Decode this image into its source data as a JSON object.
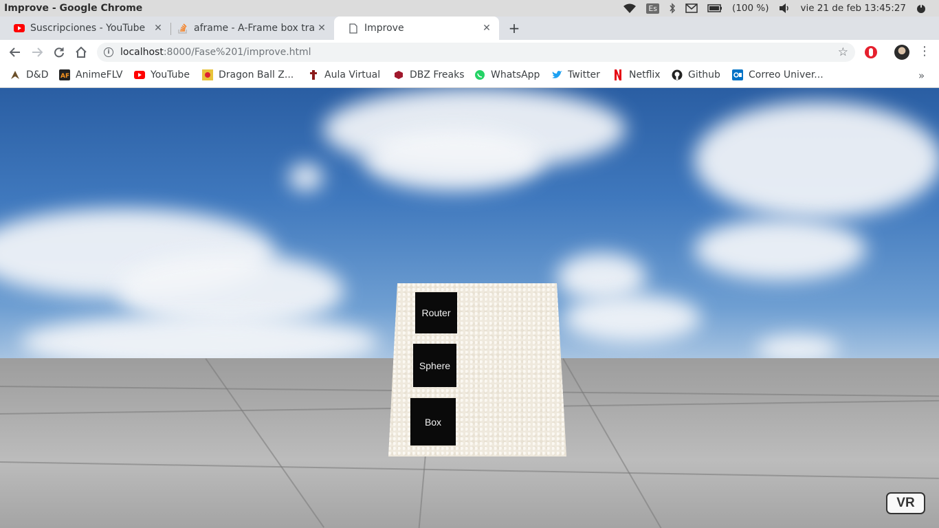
{
  "os_bar": {
    "window_title": "Improve - Google Chrome",
    "lang": "Es",
    "battery": "(100 %)",
    "datetime": "vie 21 de feb 13:45:27",
    "icons": [
      "wifi-icon",
      "bluetooth-icon",
      "mail-icon",
      "battery-icon",
      "volume-icon",
      "power-icon"
    ]
  },
  "tabs": [
    {
      "label": "Suscripciones - YouTube",
      "favicon": "youtube-icon",
      "active": false
    },
    {
      "label": "aframe - A-Frame box tran",
      "favicon": "stackoverflow-icon",
      "active": false
    },
    {
      "label": "Improve",
      "favicon": "page-icon",
      "active": true
    }
  ],
  "toolbar": {
    "url_host": "localhost",
    "url_path": ":8000/Fase%201/improve.html"
  },
  "bookmarks": [
    {
      "label": "D&D",
      "icon": "dnd-icon"
    },
    {
      "label": "AnimeFLV",
      "icon": "animeflv-icon"
    },
    {
      "label": "YouTube",
      "icon": "youtube-icon"
    },
    {
      "label": "Dragon Ball Z...",
      "icon": "dragonball-icon"
    },
    {
      "label": "Aula Virtual",
      "icon": "aula-virtual-icon"
    },
    {
      "label": "DBZ Freaks",
      "icon": "dbz-freaks-icon"
    },
    {
      "label": "WhatsApp",
      "icon": "whatsapp-icon"
    },
    {
      "label": "Twitter",
      "icon": "twitter-icon"
    },
    {
      "label": "Netflix",
      "icon": "netflix-icon"
    },
    {
      "label": "Github",
      "icon": "github-icon"
    },
    {
      "label": "Correo Univer...",
      "icon": "outlook-icon"
    }
  ],
  "scene": {
    "buttons": [
      "Router",
      "Sphere",
      "Box"
    ],
    "vr_label": "VR"
  },
  "colors": {
    "tab_strip": "#dee1e6",
    "youtube_red": "#ff0000",
    "whatsapp_green": "#25d366",
    "twitter_blue": "#1da1f2",
    "netflix_red": "#e50914",
    "outlook_blue": "#0072c6"
  }
}
